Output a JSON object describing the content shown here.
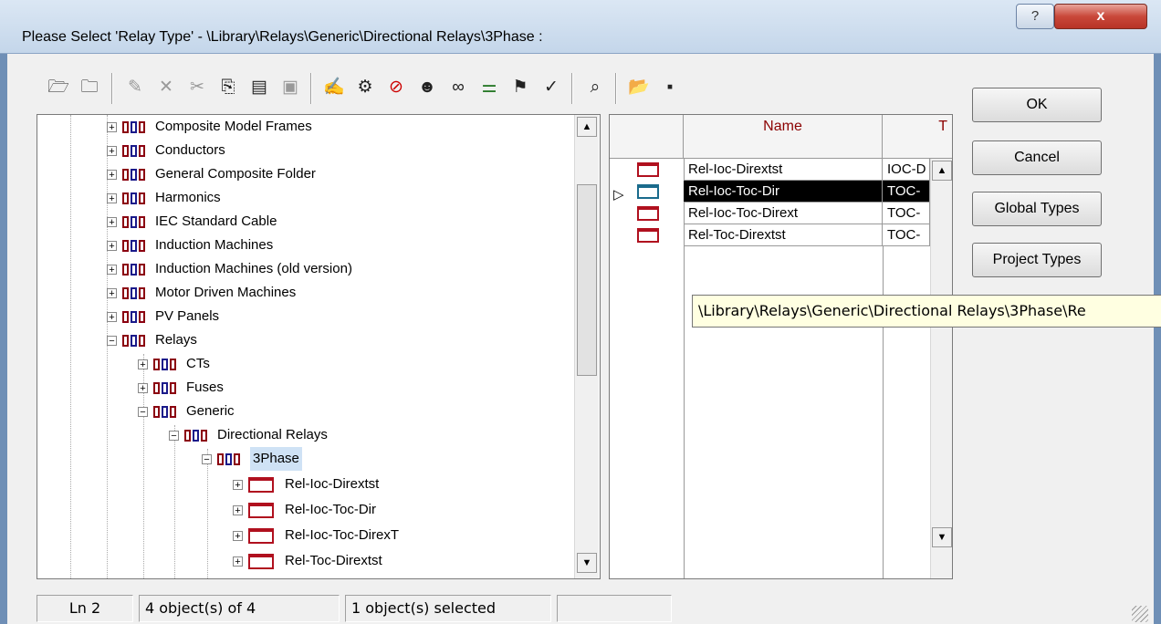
{
  "window": {
    "title": "Please Select 'Relay Type' - \\Library\\Relays\\Generic\\Directional Relays\\3Phase :",
    "help_label": "?",
    "close_label": "x"
  },
  "toolbar": {
    "icons": [
      "folder-up-icon",
      "folder-down-icon",
      "new-object-icon",
      "delete-icon",
      "cut-icon",
      "copy-icon",
      "paste-icon",
      "paste-special-icon",
      "edit-icon",
      "edit-object-icon",
      "forbidden-icon",
      "user-icon",
      "glasses-icon",
      "filter-icon",
      "tree-icon",
      "mark-icon",
      "binoculars-icon",
      "open-folder-icon",
      "save-icon"
    ]
  },
  "buttons": {
    "ok": "OK",
    "cancel": "Cancel",
    "global_types": "Global Types",
    "project_types": "Project Types"
  },
  "tree": {
    "items": [
      {
        "label": "Composite Model Frames",
        "expander": "+"
      },
      {
        "label": "Conductors",
        "expander": "+"
      },
      {
        "label": "General Composite Folder",
        "expander": "+"
      },
      {
        "label": "Harmonics",
        "expander": "+"
      },
      {
        "label": "IEC Standard Cable",
        "expander": "+"
      },
      {
        "label": "Induction Machines",
        "expander": "+"
      },
      {
        "label": "Induction Machines (old version)",
        "expander": "+"
      },
      {
        "label": "Motor Driven Machines",
        "expander": "+"
      },
      {
        "label": "PV Panels",
        "expander": "+"
      },
      {
        "label": "Relays",
        "expander": "−"
      },
      {
        "label": "CTs",
        "expander": "+"
      },
      {
        "label": "Fuses",
        "expander": "+"
      },
      {
        "label": "Generic",
        "expander": "−"
      },
      {
        "label": "Directional Relays",
        "expander": "−"
      },
      {
        "label": "3Phase",
        "expander": "−"
      },
      {
        "label": "Rel-Ioc-Dirextst",
        "expander": "+"
      },
      {
        "label": "Rel-Ioc-Toc-Dir",
        "expander": "+"
      },
      {
        "label": "Rel-Ioc-Toc-DirexT",
        "expander": "+"
      },
      {
        "label": "Rel-Toc-Dirextst",
        "expander": "+"
      }
    ]
  },
  "table": {
    "headers": {
      "name": "Name",
      "type": "T"
    },
    "rows": [
      {
        "name": "Rel-Ioc-Dirextst",
        "type": "IOC-D"
      },
      {
        "name": "Rel-Ioc-Toc-Dir",
        "type": "TOC-",
        "selected": true
      },
      {
        "name": "Rel-Ioc-Toc-Dirext",
        "type": "TOC-"
      },
      {
        "name": "Rel-Toc-Dirextst",
        "type": "TOC-"
      }
    ]
  },
  "tooltip": "\\Library\\Relays\\Generic\\Directional Relays\\3Phase\\Re",
  "status": {
    "line": "Ln 2",
    "objects": "4 object(s) of 4",
    "selected": "1 object(s) selected",
    "extra": ""
  }
}
